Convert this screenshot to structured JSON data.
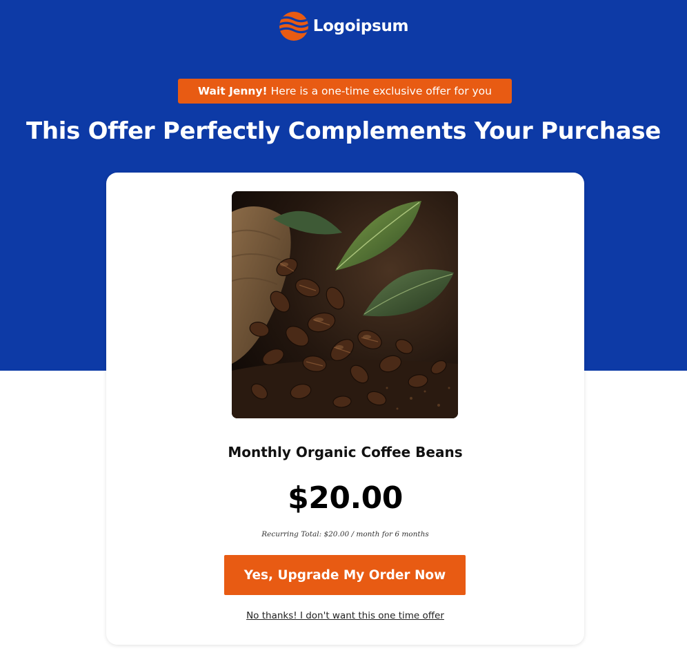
{
  "brand": {
    "name": "Logoipsum",
    "logo_icon": "logo-waves-icon",
    "accent_color": "#e85b13",
    "primary_color": "#0d3aa6"
  },
  "offer_badge": {
    "highlight": "Wait Jenny!",
    "text": "Here is a one-time exclusive offer for you"
  },
  "headline": "This Offer Perfectly Complements Your Purchase",
  "product": {
    "image_icon": "coffee-beans-image",
    "name": "Monthly Organic Coffee Beans",
    "price": "$20.00",
    "recurring_note": "Recurring Total: $20.00 / month for 6 months"
  },
  "actions": {
    "accept_label": "Yes, Upgrade My Order Now",
    "decline_label": "No thanks! I don't want this one time offer"
  }
}
